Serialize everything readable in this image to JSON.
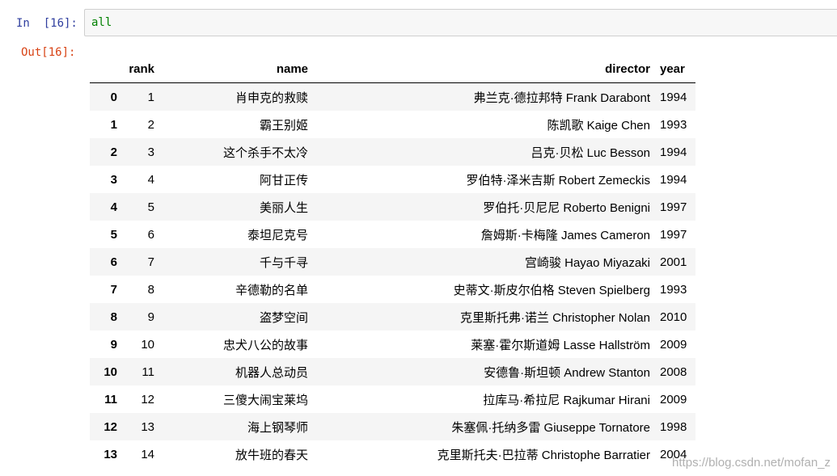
{
  "input_cell": {
    "prompt": "In  [16]:",
    "code": "all"
  },
  "output_cell": {
    "prompt": "Out[16]:"
  },
  "table": {
    "columns": [
      "rank",
      "name",
      "director",
      "year"
    ],
    "rows": [
      {
        "index": "0",
        "rank": "1",
        "name": "肖申克的救赎",
        "director": "弗兰克·德拉邦特 Frank Darabont",
        "year": "1994"
      },
      {
        "index": "1",
        "rank": "2",
        "name": "霸王别姬",
        "director": "陈凯歌 Kaige Chen",
        "year": "1993"
      },
      {
        "index": "2",
        "rank": "3",
        "name": "这个杀手不太冷",
        "director": "吕克·贝松 Luc Besson",
        "year": "1994"
      },
      {
        "index": "3",
        "rank": "4",
        "name": "阿甘正传",
        "director": "罗伯特·泽米吉斯 Robert Zemeckis",
        "year": "1994"
      },
      {
        "index": "4",
        "rank": "5",
        "name": "美丽人生",
        "director": "罗伯托·贝尼尼 Roberto Benigni",
        "year": "1997"
      },
      {
        "index": "5",
        "rank": "6",
        "name": "泰坦尼克号",
        "director": "詹姆斯·卡梅隆 James Cameron",
        "year": "1997"
      },
      {
        "index": "6",
        "rank": "7",
        "name": "千与千寻",
        "director": "宫崎骏 Hayao Miyazaki",
        "year": "2001"
      },
      {
        "index": "7",
        "rank": "8",
        "name": "辛德勒的名单",
        "director": "史蒂文·斯皮尔伯格 Steven Spielberg",
        "year": "1993"
      },
      {
        "index": "8",
        "rank": "9",
        "name": "盗梦空间",
        "director": "克里斯托弗·诺兰 Christopher Nolan",
        "year": "2010"
      },
      {
        "index": "9",
        "rank": "10",
        "name": "忠犬八公的故事",
        "director": "莱塞·霍尔斯道姆 Lasse Hallström",
        "year": "2009"
      },
      {
        "index": "10",
        "rank": "11",
        "name": "机器人总动员",
        "director": "安德鲁·斯坦顿 Andrew Stanton",
        "year": "2008"
      },
      {
        "index": "11",
        "rank": "12",
        "name": "三傻大闹宝莱坞",
        "director": "拉库马·希拉尼 Rajkumar Hirani",
        "year": "2009"
      },
      {
        "index": "12",
        "rank": "13",
        "name": "海上钢琴师",
        "director": "朱塞佩·托纳多雷 Giuseppe Tornatore",
        "year": "1998"
      },
      {
        "index": "13",
        "rank": "14",
        "name": "放牛班的春天",
        "director": "克里斯托夫·巴拉蒂 Christophe Barratier",
        "year": "2004"
      }
    ]
  },
  "watermark": "https://blog.csdn.net/mofan_z"
}
